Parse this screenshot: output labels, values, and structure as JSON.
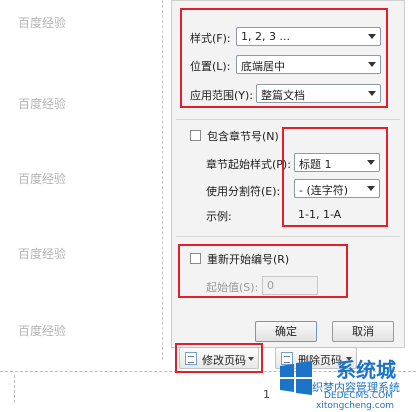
{
  "watermark": [
    "百度经验",
    "百度经验",
    "百度经验",
    "百度经验",
    "百度经验"
  ],
  "format": {
    "style_label": "样式(F):",
    "style_value": "1, 2, 3 ...",
    "position_label": "位置(L):",
    "position_value": "底端居中",
    "range_label": "应用范围(Y):",
    "range_value": "整篇文档"
  },
  "chapter": {
    "checkbox_label": "包含章节号(N)",
    "start_style_label": "章节起始样式(P):",
    "start_style_value": "标题 1",
    "separator_label": "使用分割符(E):",
    "separator_value": "-    (连字符)",
    "example_label": "示例:",
    "example_value": "1-1, 1-A"
  },
  "restart": {
    "checkbox_label": "重新开始编号(R)",
    "start_value_label": "起始值(S):",
    "start_value": "0"
  },
  "buttons": {
    "ok": "确定",
    "cancel": "取消"
  },
  "toolbar": {
    "modify_page_number": "修改页码",
    "delete_page_number": "删除页码"
  },
  "page_number_char": "1",
  "logo": {
    "brand": "系统城",
    "caption": "织梦内容管理系统",
    "domain": "DEDECMS.COM",
    "url": "xitongcheng.com"
  },
  "colors": {
    "highlight": "#e0202a",
    "brand": "#1b74c8"
  }
}
